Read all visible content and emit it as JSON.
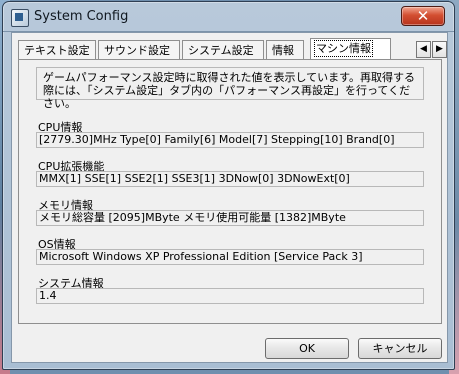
{
  "window": {
    "title": "System Config",
    "close_symbol": "✕"
  },
  "tabs": [
    {
      "label": "テキスト設定"
    },
    {
      "label": "サウンド設定"
    },
    {
      "label": "システム設定"
    },
    {
      "label": "情報"
    },
    {
      "label": "マシン情報"
    }
  ],
  "tab_nav": {
    "left": "◀",
    "right": "▶"
  },
  "info": {
    "line1": "ゲームパフォーマンス設定時に取得された値を表示しています。再取得する",
    "line2": "際には、「システム設定」タブ内の「パフォーマンス再設定」を行ってください。"
  },
  "sections": [
    {
      "label": "CPU情報",
      "value": "[2779.30]MHz Type[0]  Family[6]  Model[7]  Stepping[10]  Brand[0]"
    },
    {
      "label": "CPU拡張機能",
      "value": "MMX[1]  SSE[1]  SSE2[1]  SSE3[1]  3DNow[0]  3DNowExt[0]"
    },
    {
      "label": "メモリ情報",
      "value": "メモリ総容量  [2095]MByte  メモリ使用可能量  [1382]MByte"
    },
    {
      "label": "OS情報",
      "value": "Microsoft Windows XP Professional Edition [Service Pack 3]"
    },
    {
      "label": "システム情報",
      "value": "1.4"
    }
  ],
  "buttons": {
    "ok": "OK",
    "cancel": "キャンセル"
  }
}
